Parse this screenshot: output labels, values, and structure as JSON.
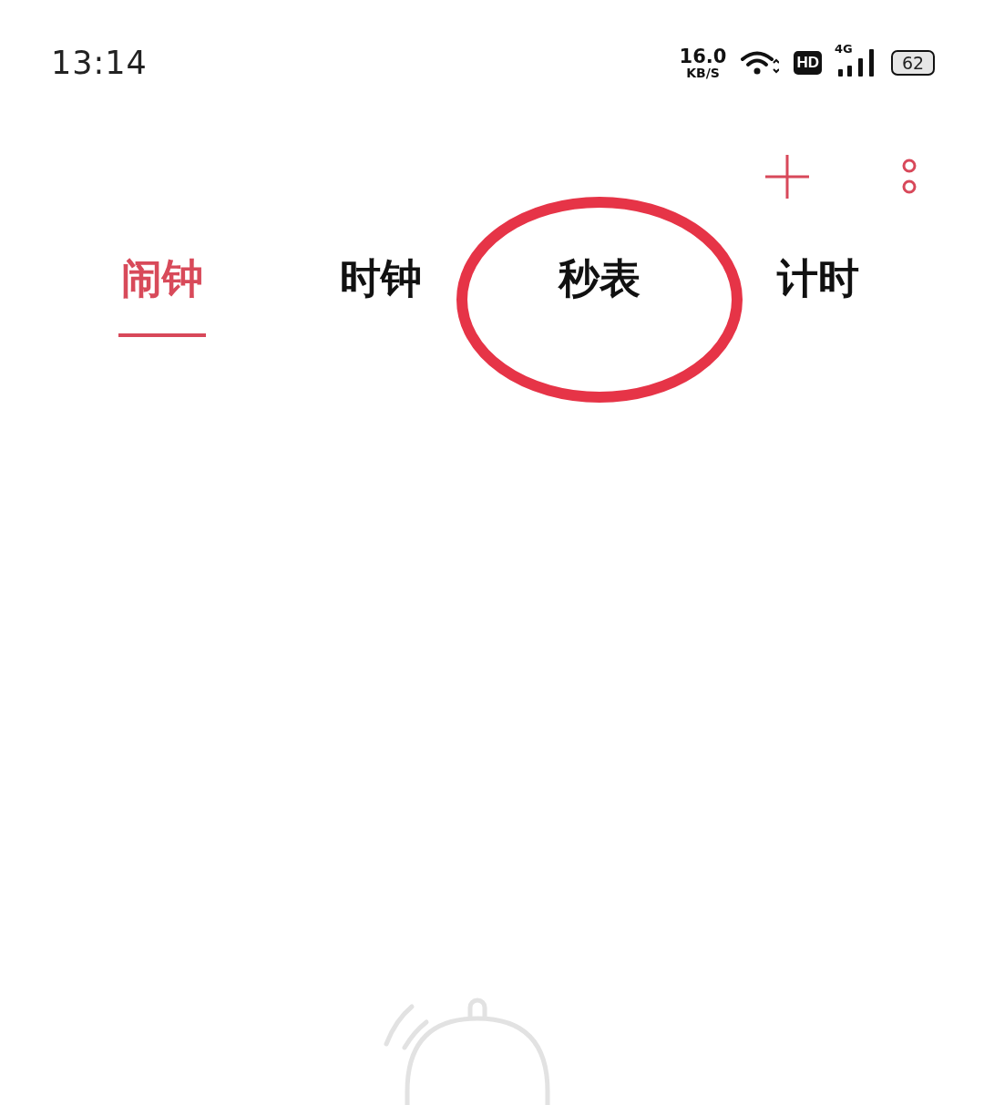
{
  "status_bar": {
    "time": "13:14",
    "speed_value": "16.0",
    "speed_unit": "KB/S",
    "hd_badge": "HD",
    "network": "4G",
    "battery": "62"
  },
  "tabs": [
    {
      "label": "闹钟",
      "selected": true
    },
    {
      "label": "时钟",
      "selected": false
    },
    {
      "label": "秒表",
      "selected": false,
      "circled": true
    },
    {
      "label": "计时",
      "selected": false
    }
  ]
}
